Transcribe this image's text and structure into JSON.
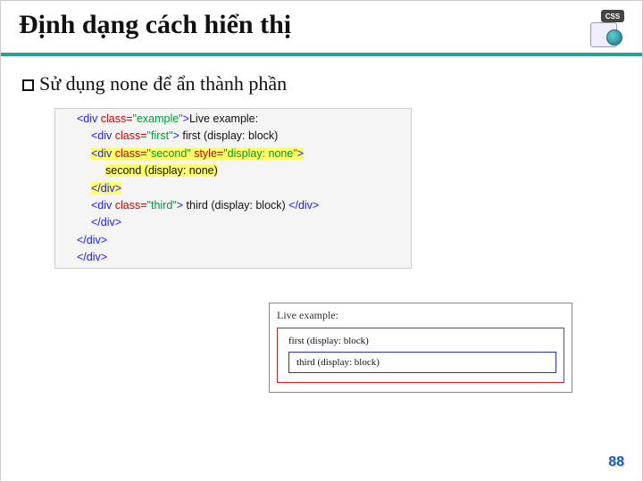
{
  "header": {
    "title": "Định dạng cách hiển thị",
    "icon_badge": "CSS"
  },
  "bullet": {
    "text": "Sử dụng none để ẩn thành phần"
  },
  "code": {
    "l1": "<div class=\"example\">Live example:",
    "l2": "<div class=\"first\"> first (display: block)",
    "l3": "<div class=\"second\" style=\"display: none\">",
    "l4": "second (display: none)",
    "l5": "</div>",
    "l6": "<div class=\"third\"> third (display: block) </div>",
    "l7": "</div>",
    "l8": "</div>",
    "l9": "</div>"
  },
  "live": {
    "label": "Live example:",
    "first": "first (display: block)",
    "third": "third (display: block)"
  },
  "page_number": "88",
  "code_tokens": {
    "div_open": "<div",
    "div_close": "</div>",
    "gt": ">",
    "class_attr": " class=",
    "style_attr": " style=",
    "q_example": "\"example\"",
    "q_first": "\"first\"",
    "q_second": "\"second\"",
    "q_third": "\"third\"",
    "q_display_none": "\"display: none\"",
    "txt_live": "Live example:",
    "txt_first": " first (display: block)",
    "txt_second": "second (display: none)",
    "txt_third": " third (display: block) "
  }
}
